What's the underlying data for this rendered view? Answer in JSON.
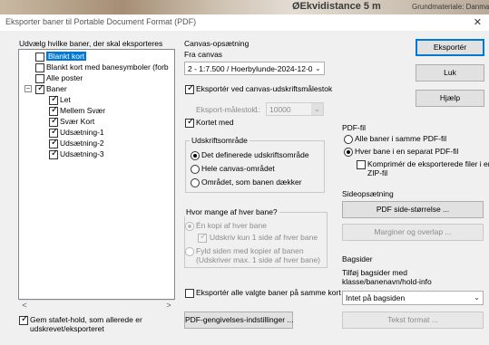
{
  "background": {
    "doc_text": "ØEkvidistance 5 m",
    "doc_text2": "Grundmateriale: Danmark"
  },
  "window": {
    "title": "Eksporter baner til Portable Document Format (PDF)",
    "close_glyph": "✕"
  },
  "left": {
    "header": "Udvælg hvilke baner, der skal eksporteres",
    "items": [
      {
        "label": "Blankt kort",
        "checked": false,
        "selected": true
      },
      {
        "label": "Blankt kort med banesymboler (forb",
        "checked": false,
        "selected": false
      },
      {
        "label": "Alle poster",
        "checked": false,
        "selected": false
      },
      {
        "label": "Baner",
        "checked": true,
        "selected": false,
        "expander": "−"
      },
      {
        "label": "Let",
        "checked": true,
        "selected": false
      },
      {
        "label": "Mellem Svær",
        "checked": true,
        "selected": false
      },
      {
        "label": "Svær Kort",
        "checked": true,
        "selected": false
      },
      {
        "label": "Udsætning-1",
        "checked": true,
        "selected": false
      },
      {
        "label": "Udsætning-2",
        "checked": true,
        "selected": false
      },
      {
        "label": "Udsætning-3",
        "checked": true,
        "selected": false
      }
    ],
    "scroll_left": "<",
    "scroll_right": ">",
    "save_state_label_1": "Gem stafet-hold, som allerede er",
    "save_state_label_2": "udskrevet/eksporteret"
  },
  "canvas": {
    "group_label": "Canvas-opsætning",
    "from_label": "Fra canvas",
    "combo_value": "2 - 1:7.500 / Hoerbylunde-2024-12-06",
    "export_scale_label": "Eksportér ved canvas-udskriftsmålestok",
    "export_scale_field_label": "Eksport-målestok",
    "scale_prefix": "1:",
    "scale_value": "10000",
    "map_included_label": "Kortet med",
    "print_area_label": "Udskriftsområde",
    "area_options": [
      "Det definerede udskriftsområde",
      "Hele canvas-området",
      "Området, som banen dækker"
    ],
    "copies_label": "Hvor mange af hver bane?",
    "one_copy_label": "Én kopi af hver bane",
    "print_one_side_label": "Udskriv kun 1 side af hver bane",
    "fill_side_label_1": "Fyld siden med kopier af banen",
    "fill_side_label_2": "(Udskriver max. 1 side af hver bane)",
    "export_all_same_label": "Eksportér alle valgte baner på samme kort",
    "pdf_settings_button": "PDF-gengivelses-indstillinger ..."
  },
  "buttons": {
    "export": "Eksportér",
    "close": "Luk",
    "help": "Hjælp"
  },
  "pdf": {
    "group_label": "PDF-fil",
    "option_same_file": "Alle baner i samme PDF-fil",
    "option_separate": "Hver bane i en separat PDF-fil",
    "compress_label_1": "Komprimér de eksporterede filer i en",
    "compress_label_2": "ZIP-fil"
  },
  "page_setup": {
    "group_label": "Sideopsætning",
    "page_size_button": "PDF side-størrelse ...",
    "margins_button": "Marginer og overlap ..."
  },
  "backpages": {
    "group_label": "Bagsider",
    "desc_1": "Tilføj bagsider med",
    "desc_2": "klasse/banenavn/hold-info",
    "combo_value": "Intet på bagsiden",
    "text_format_button": "Tekst format ..."
  },
  "icons": {
    "check": "✓",
    "dropdown": "⌄"
  }
}
